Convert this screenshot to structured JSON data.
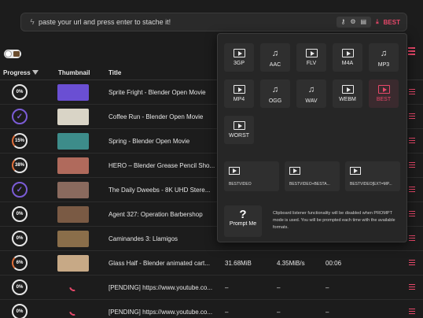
{
  "url_bar": {
    "placeholder": "paste your url and press enter to stache it!",
    "format_badge": "BEST",
    "icons": [
      "bolt-icon",
      "key-icon",
      "gear-icon",
      "clipboard-icon",
      "download-icon"
    ]
  },
  "table": {
    "headers": {
      "progress": "Progress",
      "thumbnail": "Thumbnail",
      "title": "Title"
    },
    "rows": [
      {
        "progress": "0%",
        "state": "pending",
        "title": "Sprite Fright - Blender Open Movie",
        "size": "",
        "speed": "",
        "eta": ""
      },
      {
        "progress": "✓",
        "state": "done",
        "title": "Coffee Run - Blender Open Movie",
        "size": "",
        "speed": "",
        "eta": ""
      },
      {
        "progress": "15%",
        "state": "partial",
        "title": "Spring - Blender Open Movie",
        "size": "",
        "speed": "",
        "eta": ""
      },
      {
        "progress": "38%",
        "state": "partial",
        "title": "HERO – Blender Grease Pencil Sho...",
        "size": "",
        "speed": "",
        "eta": ""
      },
      {
        "progress": "✓",
        "state": "done",
        "title": "The Daily Dweebs - 8K UHD Stere...",
        "size": "",
        "speed": "",
        "eta": ""
      },
      {
        "progress": "0%",
        "state": "pending",
        "title": "Agent 327: Operation Barbershop",
        "size": "",
        "speed": "",
        "eta": ""
      },
      {
        "progress": "0%",
        "state": "pending",
        "title": "Caminandes 3: Llamigos",
        "size": "",
        "speed": "",
        "eta": ""
      },
      {
        "progress": "6%",
        "state": "partial",
        "title": "Glass Half - Blender animated cart...",
        "size": "31.68MiB",
        "speed": "4.35MiB/s",
        "eta": "00:06"
      },
      {
        "progress": "0%",
        "state": "pending",
        "title": "[PENDING] https://www.youtube.co...",
        "size": "–",
        "speed": "–",
        "eta": "–"
      },
      {
        "progress": "0%",
        "state": "pending",
        "title": "[PENDING] https://www.youtube.co...",
        "size": "–",
        "speed": "–",
        "eta": "–"
      }
    ]
  },
  "format_menu": {
    "formats": [
      {
        "label": "3GP",
        "kind": "video"
      },
      {
        "label": "AAC",
        "kind": "audio"
      },
      {
        "label": "FLV",
        "kind": "video"
      },
      {
        "label": "M4A",
        "kind": "video"
      },
      {
        "label": "MP3",
        "kind": "audio"
      },
      {
        "label": "MP4",
        "kind": "video"
      },
      {
        "label": "OGG",
        "kind": "audio"
      },
      {
        "label": "WAV",
        "kind": "audio"
      },
      {
        "label": "WEBM",
        "kind": "video"
      },
      {
        "label": "BEST",
        "kind": "video",
        "active": true
      },
      {
        "label": "WORST",
        "kind": "video"
      }
    ],
    "combos": [
      "BESTVIDEO",
      "BESTVIDEO+BESTA...",
      "BESTVIDEO[EXT=MP..."
    ],
    "prompt_label": "Prompt Me",
    "prompt_glyph": "?",
    "note": "Clipboard listener functionality will be disabled when PROMPT mode is used. You will be prompted each time with the available formats."
  },
  "colors": {
    "accent": "#e8486a",
    "done": "#7b5cd6",
    "partial": "#e0703b"
  }
}
